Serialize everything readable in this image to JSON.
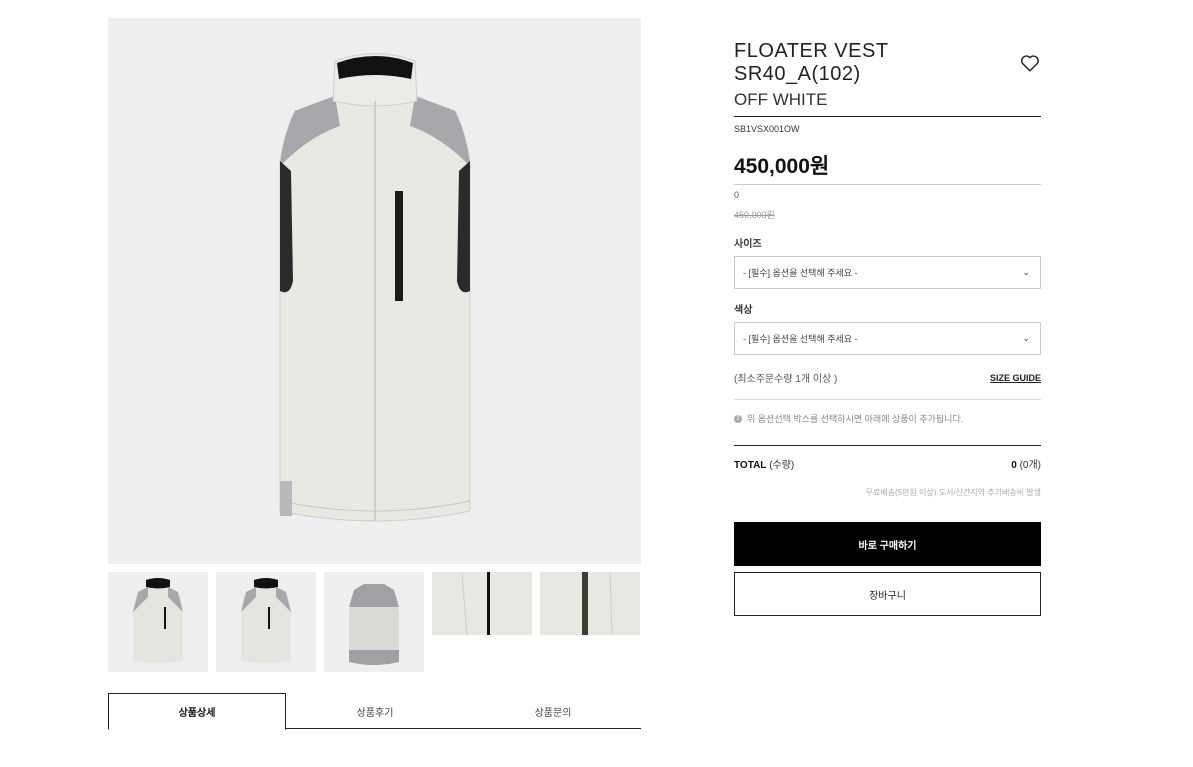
{
  "product": {
    "title": "FLOATER VEST SR40_A(102)",
    "color_name": "OFF WHITE",
    "code": "SB1VSX001OW",
    "price": "450,000원",
    "zero_value": "0",
    "original_price": "450,000원"
  },
  "options": {
    "size_label": "사이즈",
    "size_placeholder": "- [필수] 옵션을 선택해 주세요 -",
    "color_label": "색상",
    "color_placeholder": "- [필수] 옵션을 선택해 주세요 -",
    "chevron": "⌄"
  },
  "min_order": "(최소주문수량 1개 이상 )",
  "size_guide": "SIZE GUIDE",
  "notice": "위 옵션선택 박스를 선택하시면 아래에 상품이 추가됩니다.",
  "total": {
    "label": "TOTAL",
    "qty_label": "(수량)",
    "value": "0",
    "count": "(0개)"
  },
  "shipping_note": "무료배송(5만원 이상) 도서/산간지역 추가배송비 발생",
  "buttons": {
    "buy_now": "바로 구매하기",
    "cart": "장바구니"
  },
  "tabs": [
    {
      "label": "상품상세"
    },
    {
      "label": "상품후기"
    },
    {
      "label": "상품문의"
    }
  ],
  "colors": {
    "accent": "#000000",
    "image_bg": "#efefef"
  }
}
